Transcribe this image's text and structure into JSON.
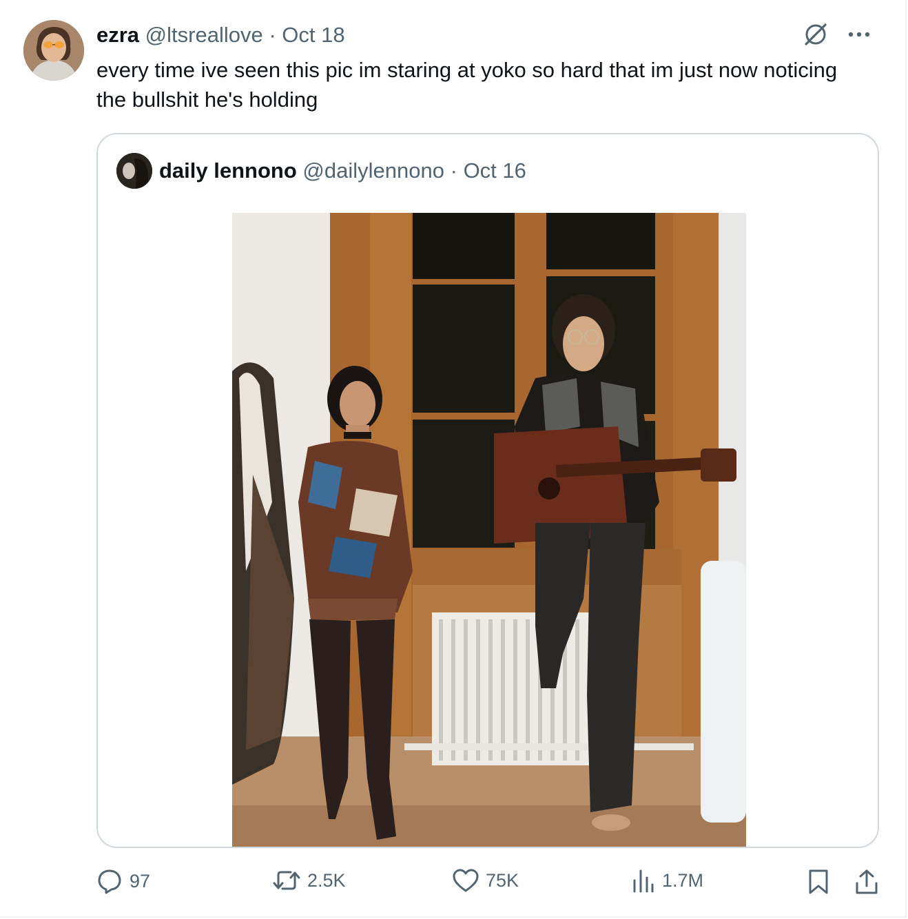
{
  "tweet": {
    "author_name": "ezra",
    "handle": "@ltsreallove",
    "separator": "·",
    "date": "Oct 18",
    "text": "every time ive seen this pic im staring at yoko so hard that im just now noticing the bullshit he's holding"
  },
  "quoted": {
    "author_name": "daily lennono",
    "handle": "@dailylennono",
    "separator": "·",
    "date": "Oct 16"
  },
  "actions": {
    "replies": "97",
    "reposts": "2.5K",
    "likes": "75K",
    "views": "1.7M"
  },
  "icons": {
    "top": [
      "grok-icon",
      "more-icon"
    ],
    "bottom": [
      "reply-icon",
      "retweet-icon",
      "like-icon",
      "views-icon",
      "bookmark-icon",
      "share-icon"
    ]
  },
  "colors": {
    "text": "#0f1419",
    "muted": "#536471",
    "border": "#cfd9de"
  }
}
